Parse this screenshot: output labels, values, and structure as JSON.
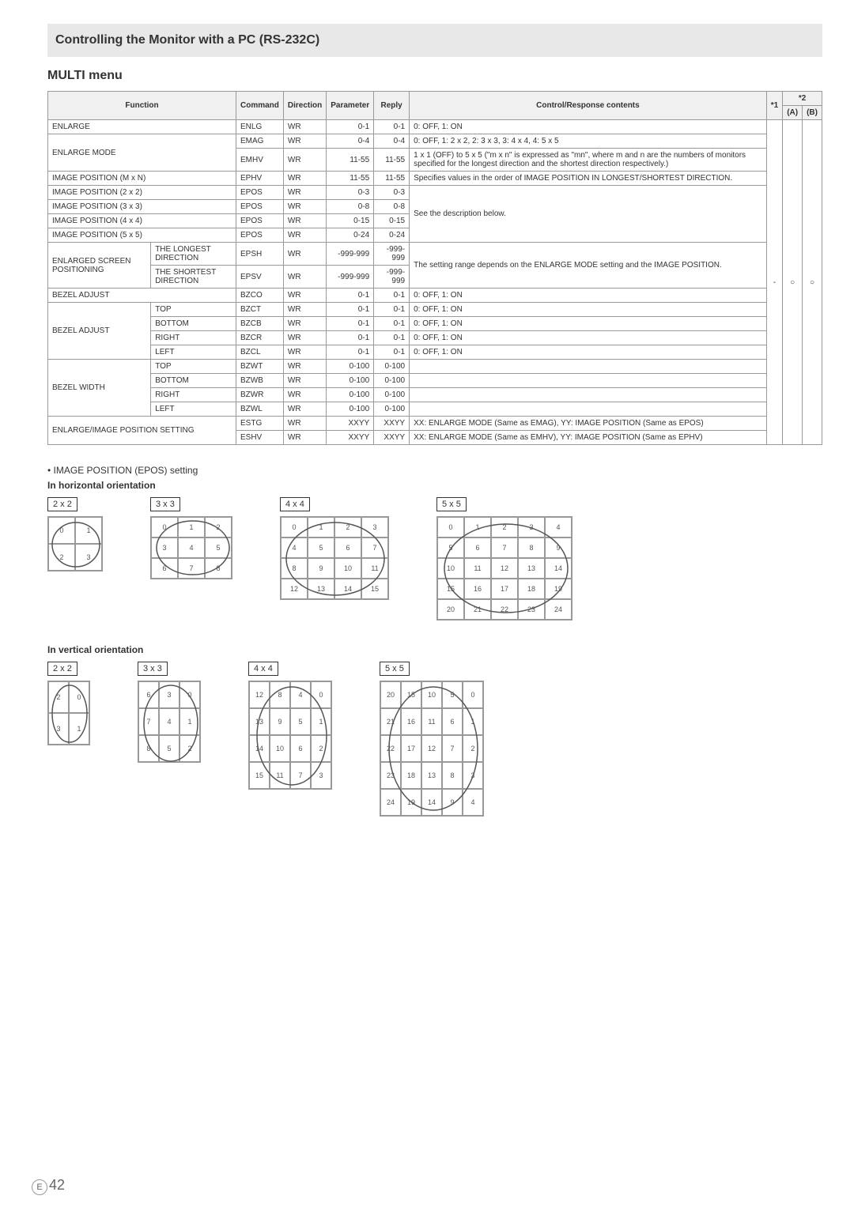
{
  "header": {
    "title": "Controlling the Monitor with a PC (RS-232C)"
  },
  "submenu": "MULTI menu",
  "table": {
    "headers": {
      "function": "Function",
      "command": "Command",
      "direction": "Direction",
      "parameter": "Parameter",
      "reply": "Reply",
      "contents": "Control/Response contents",
      "star1": "*1",
      "star2": "*2",
      "a": "(A)",
      "b": "(B)"
    },
    "rows": [
      {
        "func": "ENLARGE",
        "sub": "",
        "cmd": "ENLG",
        "dir": "WR",
        "param": "0-1",
        "reply": "0-1",
        "contents": "0: OFF, 1: ON"
      },
      {
        "func": "ENLARGE MODE",
        "sub": "",
        "cmd": "EMAG",
        "dir": "WR",
        "param": "0-4",
        "reply": "0-4",
        "contents": "0: OFF, 1: 2 x 2, 2: 3 x 3, 3: 4 x 4, 4: 5 x 5"
      },
      {
        "func": "",
        "sub": "",
        "cmd": "EMHV",
        "dir": "WR",
        "param": "11-55",
        "reply": "11-55",
        "contents": "1 x 1 (OFF) to 5 x 5 (\"m x n\" is expressed as \"mn\", where m and n are the numbers of monitors specified for the longest direction and the shortest direction respectively.)"
      },
      {
        "func": "IMAGE POSITION (M x N)",
        "sub": "",
        "cmd": "EPHV",
        "dir": "WR",
        "param": "11-55",
        "reply": "11-55",
        "contents": "Specifies values in the order of IMAGE POSITION IN LONGEST/SHORTEST DIRECTION."
      },
      {
        "func": "IMAGE POSITION (2 x 2)",
        "sub": "",
        "cmd": "EPOS",
        "dir": "WR",
        "param": "0-3",
        "reply": "0-3",
        "contents": "See the description below."
      },
      {
        "func": "IMAGE POSITION (3 x 3)",
        "sub": "",
        "cmd": "EPOS",
        "dir": "WR",
        "param": "0-8",
        "reply": "0-8",
        "contents": ""
      },
      {
        "func": "IMAGE POSITION (4 x 4)",
        "sub": "",
        "cmd": "EPOS",
        "dir": "WR",
        "param": "0-15",
        "reply": "0-15",
        "contents": ""
      },
      {
        "func": "IMAGE POSITION (5 x 5)",
        "sub": "",
        "cmd": "EPOS",
        "dir": "WR",
        "param": "0-24",
        "reply": "0-24",
        "contents": ""
      },
      {
        "func": "ENLARGED SCREEN POSITIONING",
        "sub": "THE LONGEST DIRECTION",
        "cmd": "EPSH",
        "dir": "WR",
        "param": "-999-999",
        "reply": "-999-999",
        "contents": "The setting range depends on the ENLARGE MODE setting and the IMAGE POSITION."
      },
      {
        "func": "",
        "sub": "THE SHORTEST DIRECTION",
        "cmd": "EPSV",
        "dir": "WR",
        "param": "-999-999",
        "reply": "-999-999",
        "contents": ""
      },
      {
        "func": "BEZEL ADJUST",
        "sub": "",
        "cmd": "BZCO",
        "dir": "WR",
        "param": "0-1",
        "reply": "0-1",
        "contents": "0: OFF, 1: ON"
      },
      {
        "func": "BEZEL ADJUST",
        "sub": "TOP",
        "cmd": "BZCT",
        "dir": "WR",
        "param": "0-1",
        "reply": "0-1",
        "contents": "0: OFF, 1: ON"
      },
      {
        "func": "",
        "sub": "BOTTOM",
        "cmd": "BZCB",
        "dir": "WR",
        "param": "0-1",
        "reply": "0-1",
        "contents": "0: OFF, 1: ON"
      },
      {
        "func": "",
        "sub": "RIGHT",
        "cmd": "BZCR",
        "dir": "WR",
        "param": "0-1",
        "reply": "0-1",
        "contents": "0: OFF, 1: ON"
      },
      {
        "func": "",
        "sub": "LEFT",
        "cmd": "BZCL",
        "dir": "WR",
        "param": "0-1",
        "reply": "0-1",
        "contents": "0: OFF, 1: ON"
      },
      {
        "func": "BEZEL WIDTH",
        "sub": "TOP",
        "cmd": "BZWT",
        "dir": "WR",
        "param": "0-100",
        "reply": "0-100",
        "contents": ""
      },
      {
        "func": "",
        "sub": "BOTTOM",
        "cmd": "BZWB",
        "dir": "WR",
        "param": "0-100",
        "reply": "0-100",
        "contents": ""
      },
      {
        "func": "",
        "sub": "RIGHT",
        "cmd": "BZWR",
        "dir": "WR",
        "param": "0-100",
        "reply": "0-100",
        "contents": ""
      },
      {
        "func": "",
        "sub": "LEFT",
        "cmd": "BZWL",
        "dir": "WR",
        "param": "0-100",
        "reply": "0-100",
        "contents": ""
      },
      {
        "func": "ENLARGE/IMAGE POSITION SETTING",
        "sub": "",
        "cmd": "ESTG",
        "dir": "WR",
        "param": "XXYY",
        "reply": "XXYY",
        "contents": "XX: ENLARGE MODE (Same as EMAG), YY: IMAGE POSITION (Same as EPOS)"
      },
      {
        "func": "",
        "sub": "",
        "cmd": "ESHV",
        "dir": "WR",
        "param": "XXYY",
        "reply": "XXYY",
        "contents": "XX: ENLARGE MODE (Same as EMHV), YY: IMAGE POSITION (Same as EPHV)"
      }
    ],
    "star1_val": "-",
    "star2_a_val": "○",
    "star2_b_val": "○"
  },
  "epos_note": "•  IMAGE POSITION (EPOS) setting",
  "orientation_h": "In horizontal orientation",
  "orientation_v": "In vertical orientation",
  "diagrams": {
    "labels": {
      "2x2": "2 x 2",
      "3x3": "3 x 3",
      "4x4": "4 x 4",
      "5x5": "5 x 5"
    },
    "h": {
      "g2": [
        "0",
        "1",
        "2",
        "3"
      ],
      "g3": [
        "0",
        "1",
        "2",
        "3",
        "4",
        "5",
        "6",
        "7",
        "8"
      ],
      "g4": [
        "0",
        "1",
        "2",
        "3",
        "4",
        "5",
        "6",
        "7",
        "8",
        "9",
        "10",
        "11",
        "12",
        "13",
        "14",
        "15"
      ],
      "g5": [
        "0",
        "1",
        "2",
        "3",
        "4",
        "5",
        "6",
        "7",
        "8",
        "9",
        "10",
        "11",
        "12",
        "13",
        "14",
        "15",
        "16",
        "17",
        "18",
        "19",
        "20",
        "21",
        "22",
        "23",
        "24"
      ]
    },
    "v": {
      "g2": [
        "2",
        "0",
        "3",
        "1"
      ],
      "g3": [
        "6",
        "3",
        "0",
        "7",
        "4",
        "1",
        "8",
        "5",
        "2"
      ],
      "g4": [
        "12",
        "8",
        "4",
        "0",
        "13",
        "9",
        "5",
        "1",
        "14",
        "10",
        "6",
        "2",
        "15",
        "11",
        "7",
        "3"
      ],
      "g5": [
        "20",
        "15",
        "10",
        "5",
        "0",
        "21",
        "16",
        "11",
        "6",
        "1",
        "22",
        "17",
        "12",
        "7",
        "2",
        "23",
        "18",
        "13",
        "8",
        "3",
        "24",
        "19",
        "14",
        "9",
        "4"
      ]
    }
  },
  "page_number": "42",
  "page_e": "E"
}
